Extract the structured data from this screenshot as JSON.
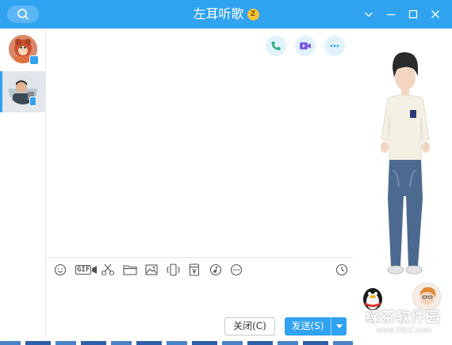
{
  "window": {
    "title": "左耳听歌",
    "vip_badge": "Z",
    "accent": "#2fa2f0"
  },
  "titlebar": {
    "search_icon": "search-icon",
    "buttons": [
      "chevron-down-icon",
      "minimize-icon",
      "maximize-icon",
      "close-icon"
    ]
  },
  "sidebar": {
    "contacts": [
      {
        "name": "group-avatar",
        "selected": false
      },
      {
        "name": "contact-avatar",
        "selected": true
      }
    ]
  },
  "chat": {
    "call_buttons": [
      "voice-call-icon",
      "video-call-icon",
      "more-icon"
    ],
    "toolbar": {
      "gif_label": "GIF",
      "icons": [
        "emoji-icon",
        "gif-icon",
        "screenshot-scissors-icon",
        "folder-icon",
        "image-icon",
        "shake-icon",
        "red-packet-icon",
        "music-icon",
        "more-icon",
        "history-clock-icon"
      ]
    },
    "close_button": "关闭(C)",
    "send_button": "发送(S)"
  },
  "watermark": {
    "text": "绿茶软件园",
    "url": "www.33LC.com"
  }
}
